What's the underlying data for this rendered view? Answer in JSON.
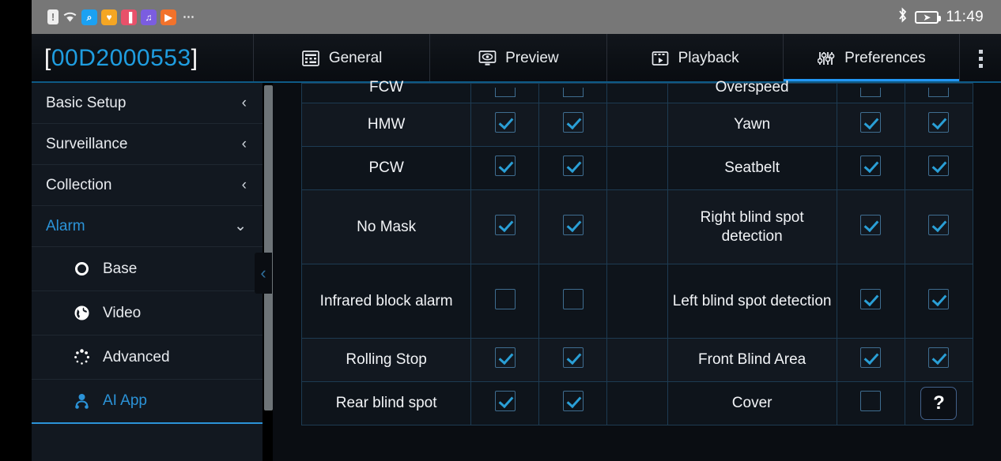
{
  "statusbar": {
    "icons": [
      "document-alert-icon",
      "wifi-icon",
      "search-icon",
      "heart-icon",
      "book-icon",
      "music-icon",
      "play-icon",
      "overflow-icon"
    ],
    "doc_glyph": "!",
    "wifi_glyph": "▰",
    "search_glyph": "⌕",
    "heart_glyph": "♥",
    "book_glyph": "▐",
    "music_glyph": "♫",
    "play_glyph": "▶",
    "more_glyph": "⋯",
    "bluetooth_glyph": "ᛦ",
    "battery_glyph": "➤",
    "time": "11:49"
  },
  "header": {
    "device_id": "00D2000553",
    "bracket_left": "[",
    "bracket_right": "]",
    "kebab_label": "more-options"
  },
  "tabs": [
    {
      "label": "General",
      "icon": "grid-icon",
      "glyph": "⌸",
      "active": false
    },
    {
      "label": "Preview",
      "icon": "monitor-eye-icon",
      "glyph": "▣",
      "active": false
    },
    {
      "label": "Playback",
      "icon": "film-play-icon",
      "glyph": "▷",
      "active": false
    },
    {
      "label": "Preferences",
      "icon": "sliders-icon",
      "glyph": "⫴",
      "active": true
    }
  ],
  "sidebar": {
    "items": [
      {
        "label": "Basic Setup",
        "chevron": "‹",
        "active": false
      },
      {
        "label": "Surveillance",
        "chevron": "‹",
        "active": false
      },
      {
        "label": "Collection",
        "chevron": "‹",
        "active": false
      },
      {
        "label": "Alarm",
        "chevron": "⌄",
        "active": true
      }
    ],
    "subitems": [
      {
        "label": "Base",
        "icon": "circle-icon",
        "glyph": "",
        "active": false
      },
      {
        "label": "Video",
        "icon": "globe-icon",
        "glyph": "◕",
        "active": false
      },
      {
        "label": "Advanced",
        "icon": "spinner-icon",
        "glyph": "◌",
        "active": false
      },
      {
        "label": "AI App",
        "icon": "ai-person-icon",
        "glyph": "⛉",
        "active": true
      }
    ],
    "collapse_handle": "‹"
  },
  "table": {
    "rows": [
      {
        "left_label": "FCW",
        "left_c1": true,
        "left_c2": true,
        "right_label": "Overspeed",
        "right_c1": true,
        "right_c2": true,
        "clipped": true,
        "tall": false,
        "help": false
      },
      {
        "left_label": "HMW",
        "left_c1": true,
        "left_c2": true,
        "right_label": "Yawn",
        "right_c1": true,
        "right_c2": true,
        "clipped": false,
        "tall": false,
        "help": false
      },
      {
        "left_label": "PCW",
        "left_c1": true,
        "left_c2": true,
        "right_label": "Seatbelt",
        "right_c1": true,
        "right_c2": true,
        "clipped": false,
        "tall": false,
        "help": false
      },
      {
        "left_label": "No Mask",
        "left_c1": true,
        "left_c2": true,
        "right_label": "Right blind spot detection",
        "right_c1": true,
        "right_c2": true,
        "clipped": false,
        "tall": true,
        "help": false
      },
      {
        "left_label": "Infrared block alarm",
        "left_c1": false,
        "left_c2": false,
        "right_label": "Left blind spot detection",
        "right_c1": true,
        "right_c2": true,
        "clipped": false,
        "tall": true,
        "help": false
      },
      {
        "left_label": "Rolling Stop",
        "left_c1": true,
        "left_c2": true,
        "right_label": "Front Blind Area",
        "right_c1": true,
        "right_c2": true,
        "clipped": false,
        "tall": false,
        "help": false
      },
      {
        "left_label": "Rear blind spot",
        "left_c1": true,
        "left_c2": true,
        "right_label": "Cover",
        "right_c1": false,
        "right_c2": null,
        "clipped": false,
        "tall": false,
        "help": true
      }
    ],
    "help_button_label": "?"
  },
  "colors": {
    "accent_blue": "#2196f3",
    "link_blue": "#2b93d8",
    "title_blue": "#1f9de0",
    "grid_border": "#1d3b52",
    "panel_dark": "#0a0d12",
    "panel_row": "#121820",
    "statusbar_gray": "#777777"
  }
}
